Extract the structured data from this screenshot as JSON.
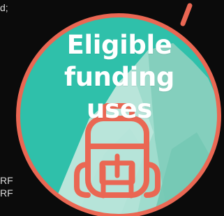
{
  "background_text": {
    "top_fragment": "d;",
    "rf_line_1": "RF",
    "rf_line_2": "RF"
  },
  "badge": {
    "title_line_1": "Eligible",
    "title_line_2": "funding uses",
    "icon": "backpack-icon",
    "decor": "mountain-illustration",
    "colors": {
      "teal": "#2fc0aa",
      "ring": "#ea6753",
      "mountain_light": "#a9ddcf",
      "mountain_mid": "#87d1c1",
      "backpack": "#ea6753",
      "text": "#ffffff",
      "page_bg": "#0b0b0b"
    }
  }
}
